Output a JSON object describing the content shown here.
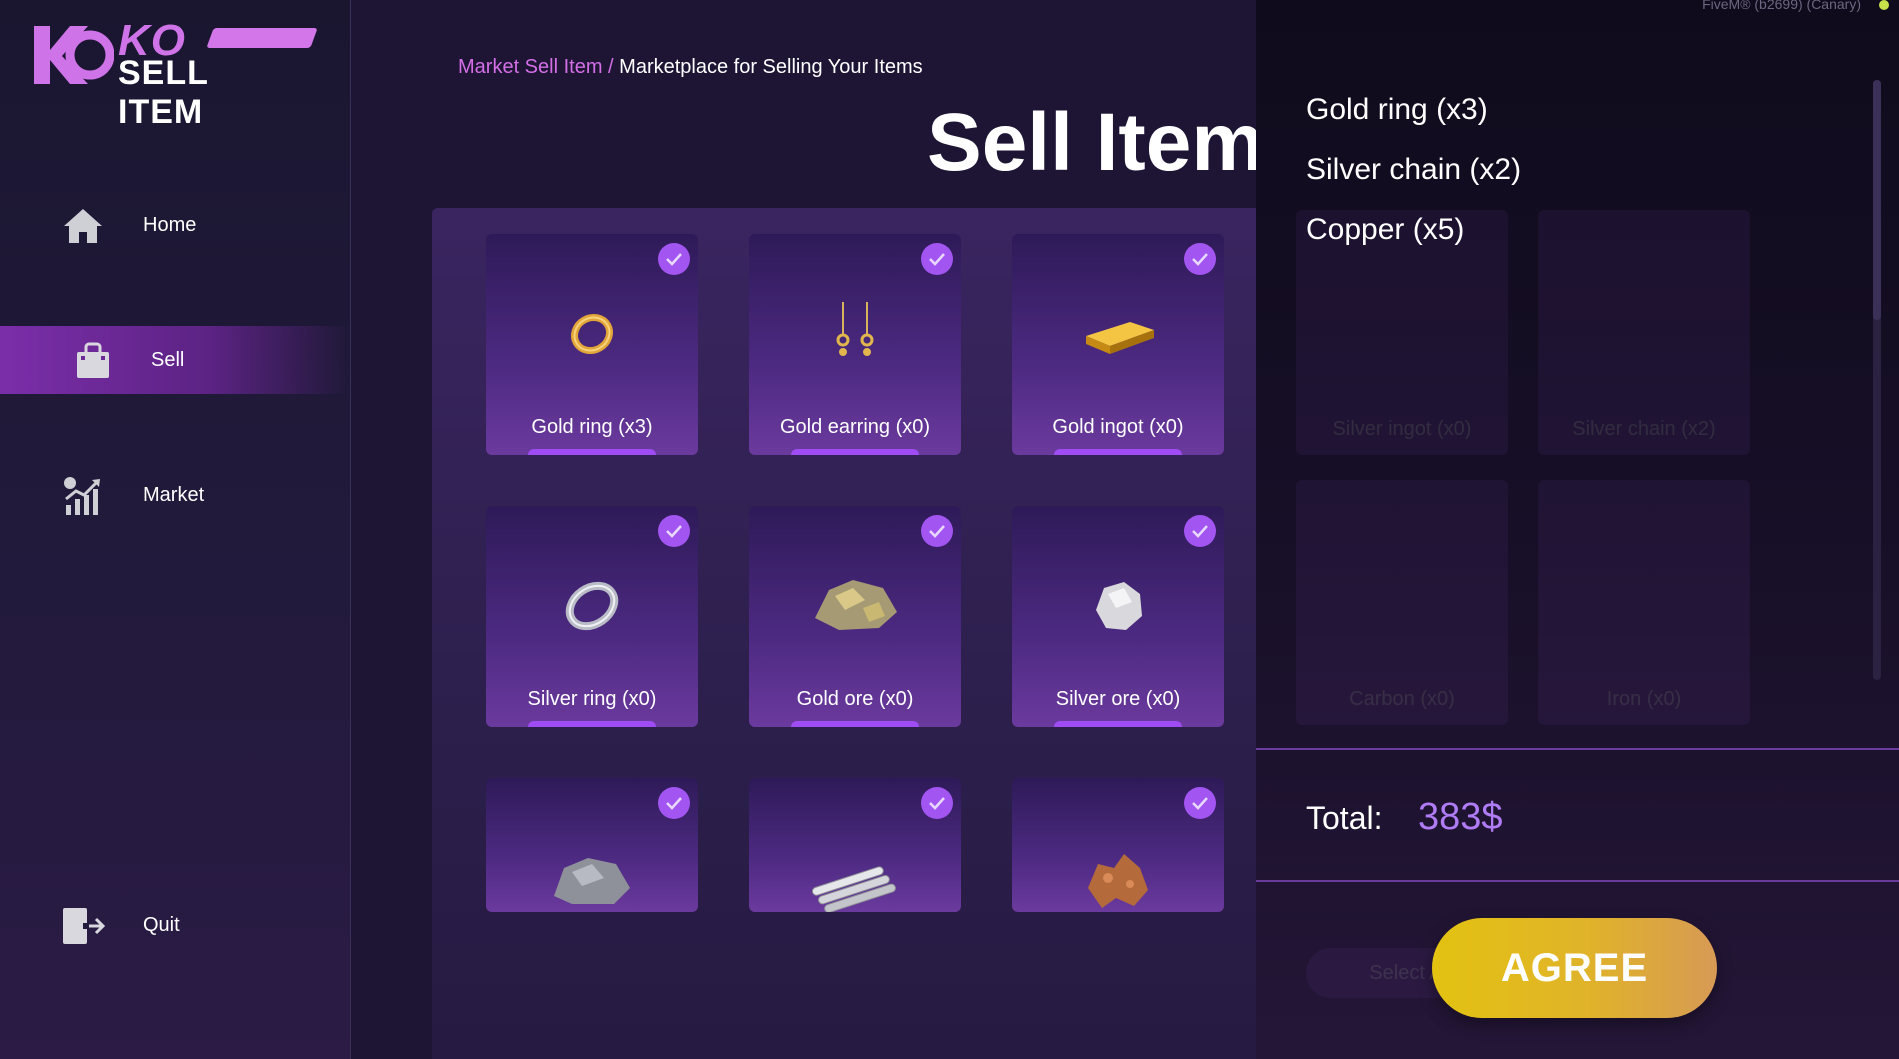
{
  "app": {
    "logo_text": "KO",
    "logo_title": "SELL ITEM"
  },
  "nav": {
    "items": [
      {
        "label": "Home",
        "icon": "home-icon"
      },
      {
        "label": "Sell",
        "icon": "shopping-bag-icon",
        "active": true
      },
      {
        "label": "Market",
        "icon": "chart-icon"
      },
      {
        "label": "Quit",
        "icon": "exit-icon"
      }
    ]
  },
  "breadcrumb": {
    "link": "Market Sell Item",
    "separator": "/",
    "current": "Marketplace for Selling Your Items"
  },
  "page": {
    "title": "Sell Items"
  },
  "items": [
    {
      "label": "Gold ring (x3)",
      "icon": "gold-ring-icon"
    },
    {
      "label": "Gold earring (x0)",
      "icon": "gold-earring-icon"
    },
    {
      "label": "Gold ingot (x0)",
      "icon": "gold-ingot-icon"
    },
    {
      "label": "Silver ring (x0)",
      "icon": "silver-ring-icon"
    },
    {
      "label": "Gold ore (x0)",
      "icon": "gold-ore-icon"
    },
    {
      "label": "Silver ore (x0)",
      "icon": "silver-ore-icon"
    },
    {
      "label": "",
      "icon": "iron-ore-icon"
    },
    {
      "label": "",
      "icon": "metal-bars-icon"
    },
    {
      "label": "",
      "icon": "copper-ore-icon"
    }
  ],
  "hidden_items": [
    {
      "label": "Silver ingot (x0)"
    },
    {
      "label": "Silver chain (x2)"
    },
    {
      "label": "Carbon (x0)"
    },
    {
      "label": "Iron (x0)"
    }
  ],
  "summary": {
    "items": [
      "Gold ring (x3)",
      "Silver chain (x2)",
      "Copper (x5)"
    ],
    "total_label": "Total:",
    "total_value": "383$",
    "agree_label": "AGREE",
    "hidden_select_label": "Select A"
  },
  "watermark": "FiveM® (b2699) (Canary)",
  "colors": {
    "accent": "#a255f0",
    "highlight": "#d46ee6",
    "total": "#b07cf5",
    "button_start": "#e3c211",
    "button_end": "#d79a55"
  }
}
